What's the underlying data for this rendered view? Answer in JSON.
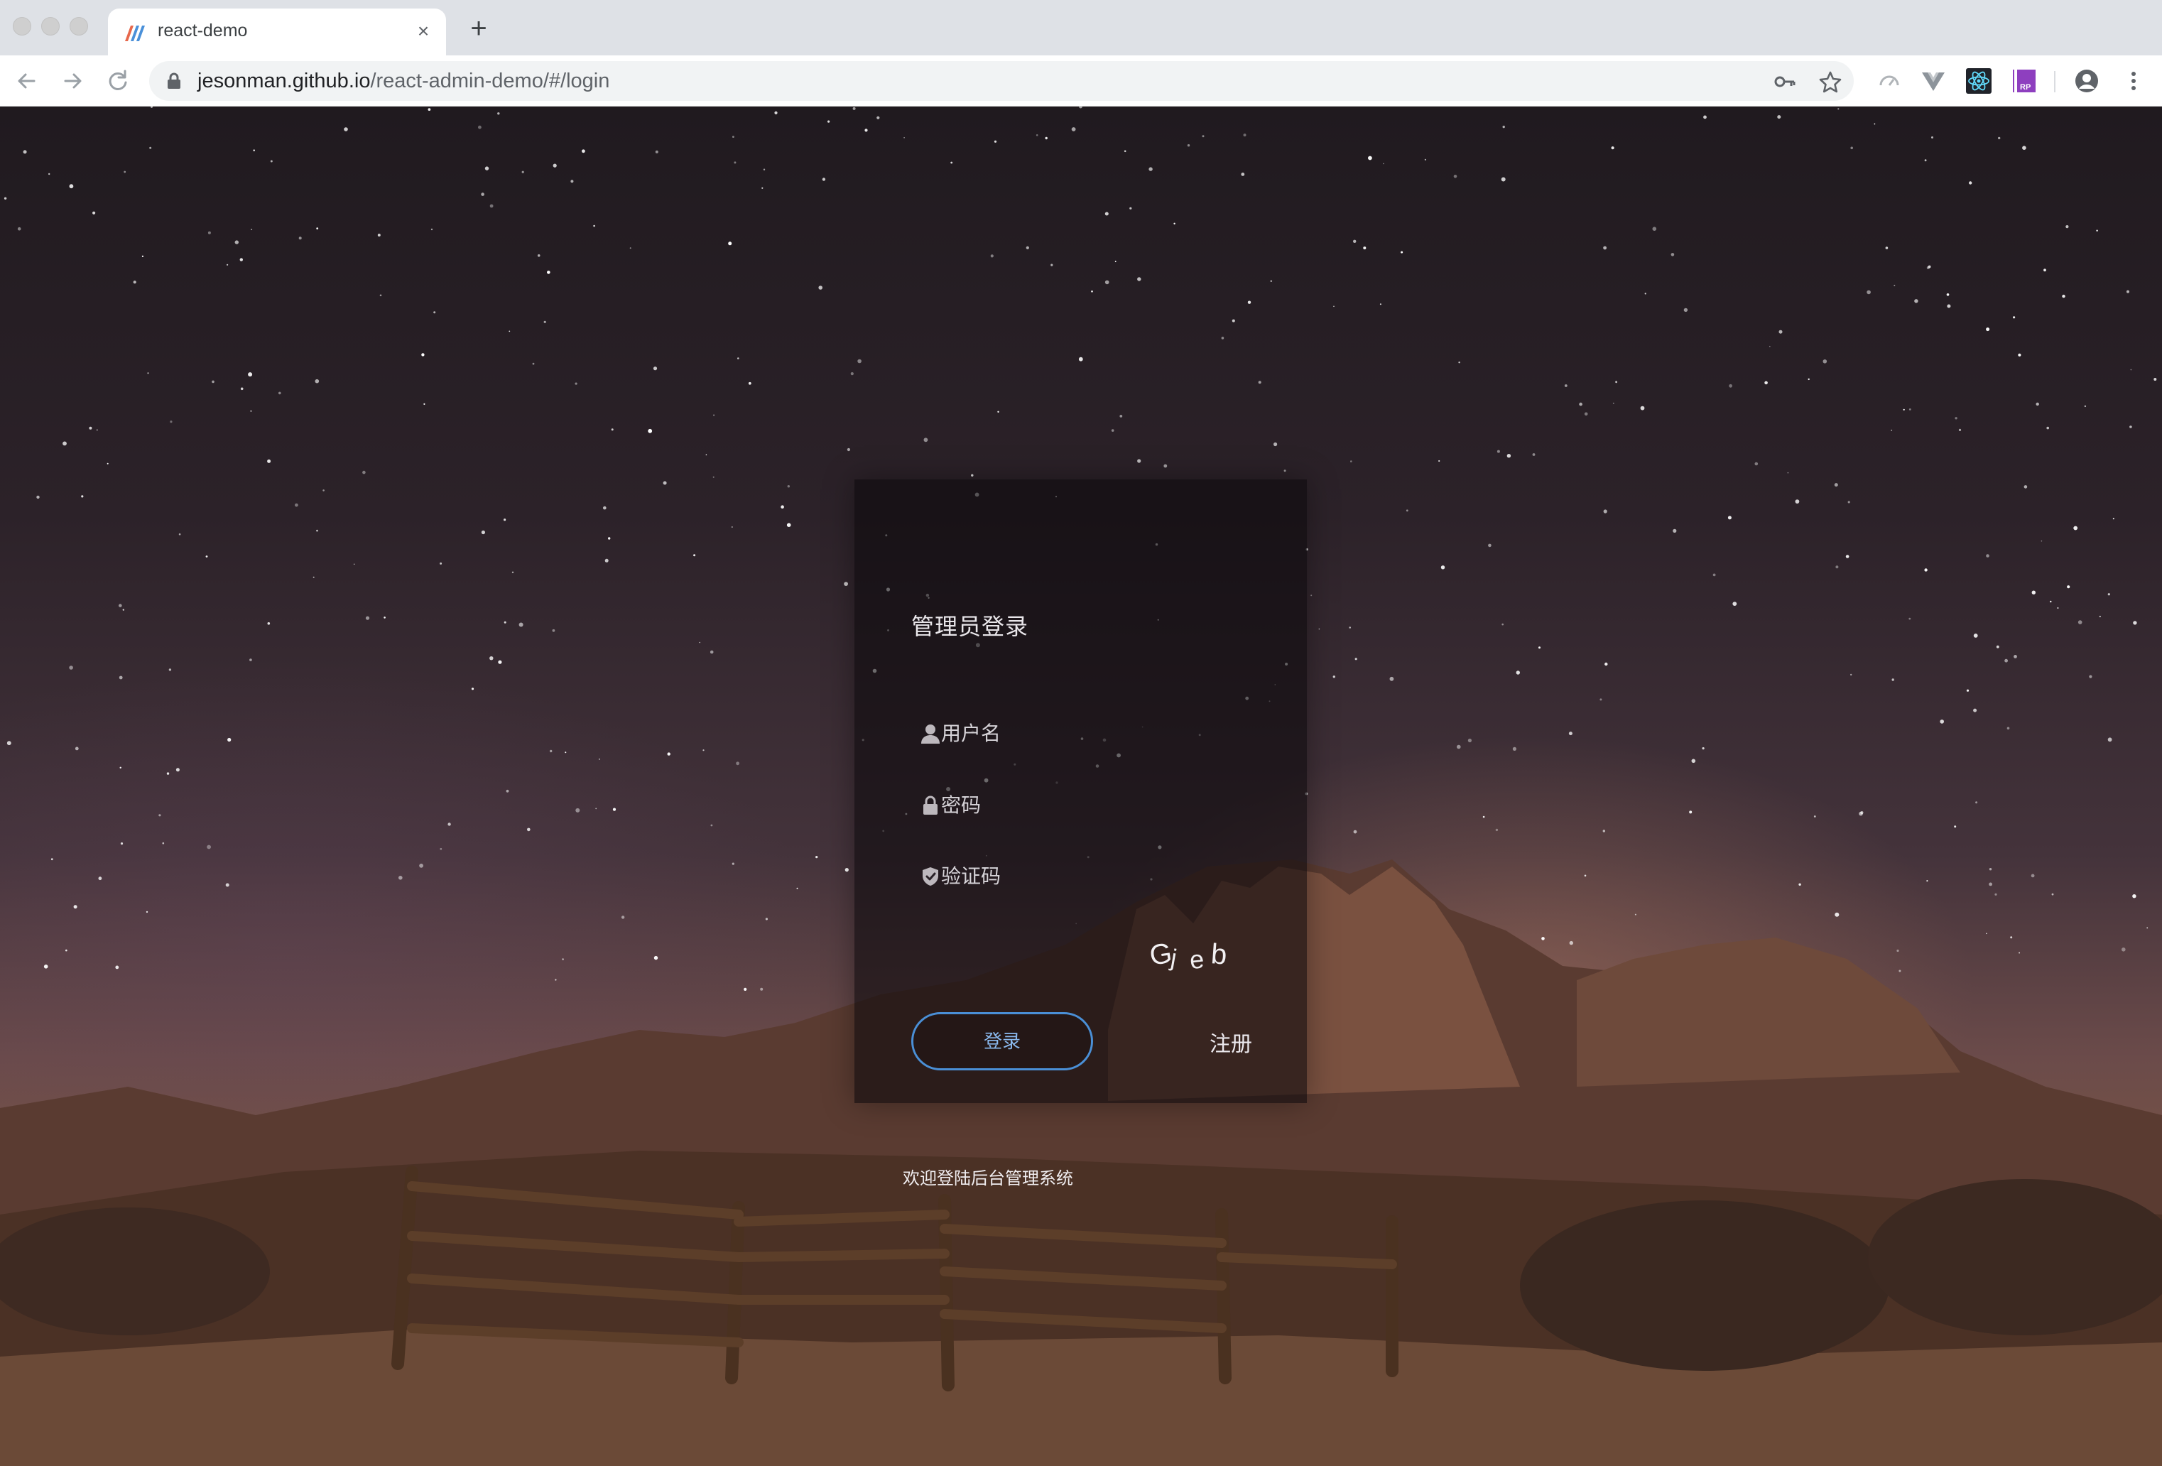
{
  "browser": {
    "tab": {
      "title": "react-demo",
      "close_glyph": "×"
    },
    "new_tab_glyph": "+",
    "url": {
      "domain": "jesonman.github.io",
      "path": "/react-admin-demo/#/login"
    },
    "icons": {
      "back": "arrow-left-icon",
      "forward": "arrow-right-icon",
      "reload": "reload-icon",
      "lock": "lock-icon",
      "key": "key-icon",
      "bookmark": "star-icon",
      "extensions": [
        "speed-icon",
        "vue-devtools-icon",
        "react-devtools-icon",
        "rp-extension-icon"
      ],
      "profile": "profile-icon",
      "menu": "more-vertical-icon"
    }
  },
  "login": {
    "title": "管理员登录",
    "username": {
      "placeholder": "用户名",
      "icon": "user-icon"
    },
    "password": {
      "placeholder": "密码",
      "icon": "lock-icon"
    },
    "captcha": {
      "placeholder": "验证码",
      "icon": "shield-check-icon",
      "code": "Gjeb"
    },
    "login_button": "登录",
    "register_link": "注册",
    "footer": "欢迎登陆后台管理系统"
  },
  "colors": {
    "accent": "#4a8fd6",
    "login_text": "#8ab9ee",
    "card_bg": "rgba(12,8,12,0.60)"
  }
}
